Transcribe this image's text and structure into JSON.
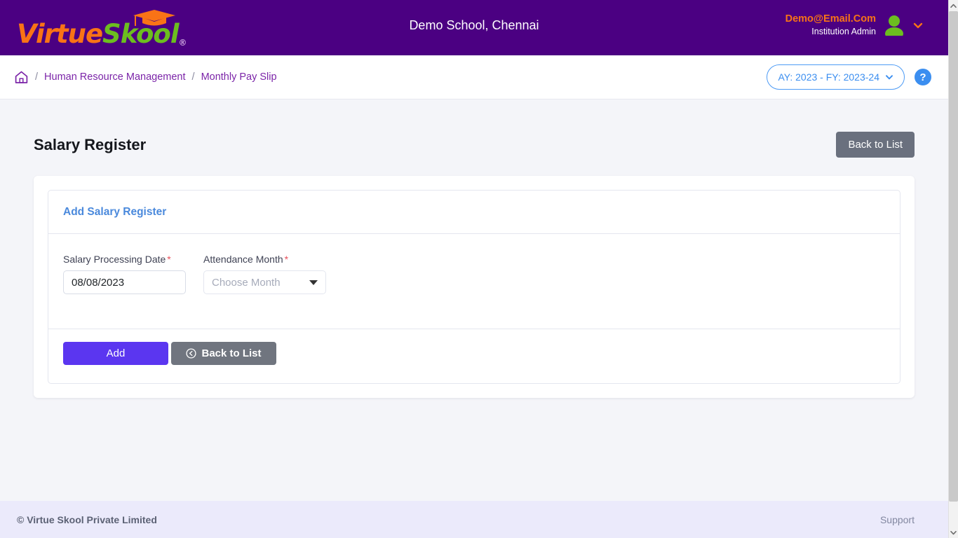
{
  "topbar": {
    "brand": {
      "part1": "Virtue",
      "part2": "Skool",
      "registered": "®",
      "cap_icon": "graduation-cap-icon"
    },
    "school_title": "Demo School, Chennai",
    "user": {
      "email": "Demo@Email.Com",
      "role": "Institution Admin",
      "avatar_icon": "user-avatar-icon",
      "caret_icon": "chevron-down-icon"
    },
    "colors": {
      "bg": "#4b0082",
      "brand_orange": "#f97316",
      "brand_green": "#6cbe1f"
    }
  },
  "breadcrumb": {
    "home_icon": "home-icon",
    "separator": "/",
    "items": [
      {
        "label": "Human Resource Management"
      },
      {
        "label": "Monthly Pay Slip"
      }
    ],
    "academic_year": {
      "label": "AY: 2023 - FY: 2023-24",
      "caret_icon": "chevron-down-icon"
    },
    "help_label": "?",
    "accent": "#3b8ef0"
  },
  "page": {
    "title": "Salary Register",
    "back_to_list_top": "Back to List"
  },
  "card": {
    "header_title": "Add Salary Register",
    "header_color": "#4a89dc",
    "fields": [
      {
        "label": "Salary Processing Date",
        "required": "*",
        "type": "text",
        "value": "08/08/2023",
        "placeholder": ""
      },
      {
        "label": "Attendance Month",
        "required": "*",
        "type": "select",
        "value": "",
        "placeholder": "Choose Month"
      }
    ],
    "actions": {
      "add_label": "Add",
      "add_color": "#5b36f0",
      "back_label": "Back to List",
      "back_icon": "circle-arrow-left-icon",
      "back_color": "#70757f"
    }
  },
  "footer": {
    "copyright": "© Virtue Skool Private Limited",
    "support": "Support"
  },
  "scrollbar": {
    "up_icon": "chevron-up-icon",
    "down_icon": "chevron-down-icon"
  }
}
